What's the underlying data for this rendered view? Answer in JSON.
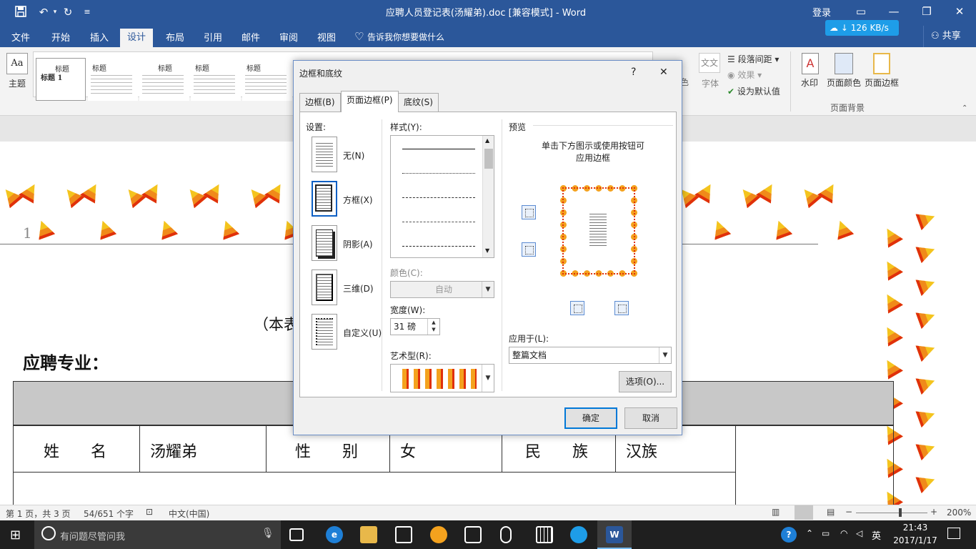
{
  "window": {
    "title": "应聘人员登记表(汤耀弟).doc [兼容模式]  -  Word",
    "login": "登录"
  },
  "tabs": [
    "文件",
    "开始",
    "插入",
    "设计",
    "布局",
    "引用",
    "邮件",
    "审阅",
    "视图"
  ],
  "tell_me": "告诉我你想要做什么",
  "share": "共享",
  "net_speed": "126 KB/s",
  "ribbon": {
    "theme": "主题",
    "styles": [
      "标题",
      "标题",
      "标题",
      "标题",
      "标题",
      "标题",
      "标题",
      "标题",
      "标题",
      "标题"
    ],
    "style_sub": "标题 1",
    "colors_label": "色",
    "fonts_label": "文文",
    "fonts_name": "字体",
    "para_spacing": "段落间距",
    "effects": "效果",
    "set_default": "设为默认值",
    "watermark": "水印",
    "page_color": "页面颜色",
    "page_borders": "页面边框",
    "group_page_bg": "页面背景"
  },
  "document": {
    "page_marker": "1",
    "note": "（本表",
    "major": "应聘专业：",
    "row1": [
      "姓　　名",
      "汤耀弟",
      "性　　别",
      "女",
      "民　　族",
      "汉族"
    ]
  },
  "dialog": {
    "title": "边框和底纹",
    "help": "?",
    "close": "✕",
    "tabs": [
      {
        "label": "边框(B)"
      },
      {
        "label": "页面边框(P)"
      },
      {
        "label": "底纹(S)"
      }
    ],
    "settings_title": "设置:",
    "settings": [
      "无(N)",
      "方框(X)",
      "阴影(A)",
      "三维(D)",
      "自定义(U)"
    ],
    "style_title": "样式(Y):",
    "color_title": "颜色(C):",
    "color_value": "自动",
    "width_title": "宽度(W):",
    "width_value": "31 磅",
    "art_title": "艺术型(R):",
    "preview_title": "预览",
    "preview_hint_1": "单击下方图示或使用按钮可",
    "preview_hint_2": "应用边框",
    "apply_title": "应用于(L):",
    "apply_value": "整篇文档",
    "options_button": "选项(O)...",
    "ok_button": "确定",
    "cancel_button": "取消"
  },
  "statusbar": {
    "page": "第 1 页，共 3 页",
    "words": "54/651 个字",
    "lang": "中文(中国)",
    "zoom": "200%"
  },
  "taskbar": {
    "search_placeholder": "有问题尽管问我",
    "ime": "英",
    "time": "21:43",
    "date": "2017/1/17"
  },
  "colors": {
    "word_blue": "#2b579a",
    "accent": "#0078d7",
    "candy_yellow": "#f4a21e",
    "candy_red": "#e0300b"
  }
}
